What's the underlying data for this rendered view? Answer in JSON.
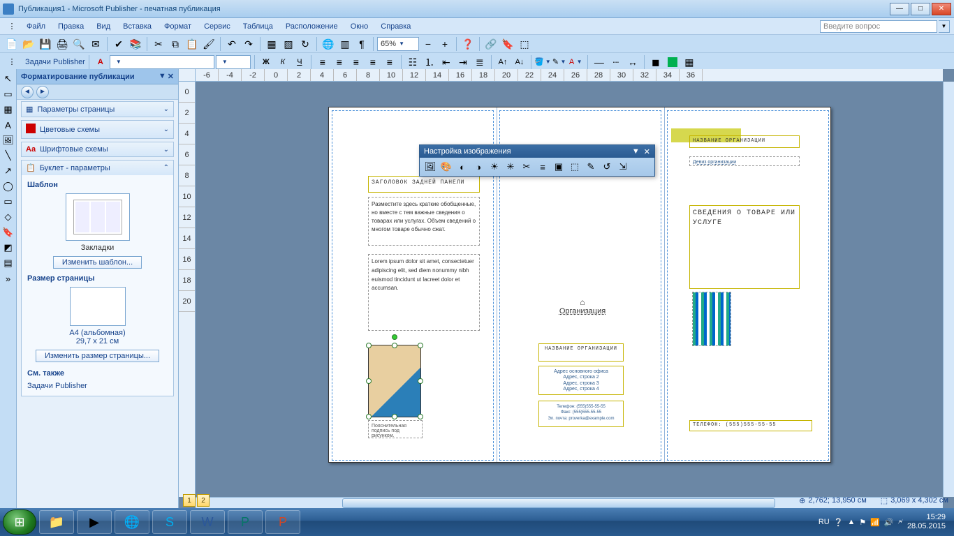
{
  "window": {
    "title": "Публикация1 - Microsoft Publisher - печатная публикация"
  },
  "menu": {
    "file": "Файл",
    "edit": "Правка",
    "view": "Вид",
    "insert": "Вставка",
    "format": "Формат",
    "tools": "Сервис",
    "table": "Таблица",
    "arrange": "Расположение",
    "window": "Окно",
    "help": "Справка",
    "help_placeholder": "Введите вопрос"
  },
  "toolbar1": {
    "zoom": "65%"
  },
  "toolbar2": {
    "tasks_label": "Задачи Publisher"
  },
  "taskpane": {
    "title": "Форматирование публикации",
    "sections": {
      "page_options": "Параметры страницы",
      "color_schemes": "Цветовые схемы",
      "font_schemes": "Шрифтовые схемы",
      "booklet_options": "Буклет - параметры"
    },
    "template_title": "Шаблон",
    "template_name": "Закладки",
    "change_template_btn": "Изменить шаблон...",
    "page_size_title": "Размер страницы",
    "page_size_name": "A4 (альбомная)",
    "page_size_dims": "29,7 x 21 см",
    "change_size_btn": "Изменить размер страницы...",
    "see_also": "См. также",
    "tasks_link": "Задачи Publisher"
  },
  "float_toolbar": {
    "title": "Настройка изображения"
  },
  "document": {
    "panel1": {
      "heading": "ЗАГОЛОВОК ЗАДНЕЙ ПАНЕЛИ",
      "body1": "Разместите здесь краткие обобщенные, но вместе с тем важные сведения о товарах или услугах. Объем сведений о многом товаре обычно сжат.",
      "body2": "Lorem ipsum dolor sit amet, consectetuer adipiscing elit, sed diem nonummy nibh euismod tincidunt ut lacreet dolor et accumsan.",
      "caption": "Пояснительная подпись под рисунком."
    },
    "panel2": {
      "org_label": "Организация",
      "org_name": "НАЗВАНИЕ ОРГАНИЗАЦИИ",
      "addr": "Адрес основного офиса\nАдрес, строка 2\nАдрес, строка 3\nАдрес, строка 4",
      "contact": "Телефон: (555)555-55-55\nФакс: (555)555-55-55\nЭл. почта: proverka@example.com"
    },
    "panel3": {
      "org_name": "НАЗВАНИЕ ОРГАНИЗАЦИИ",
      "slogan": "Девиз организации",
      "heading": "СВЕДЕНИЯ О ТОВАРЕ ИЛИ УСЛУГЕ",
      "phone": "ТЕЛЕФОН: (555)555-55-55"
    }
  },
  "status": {
    "pos": "2,762; 13,950 см",
    "size": "3,069 x  4,302 см"
  },
  "page_tabs": {
    "p1": "1",
    "p2": "2"
  },
  "systray": {
    "lang": "RU",
    "time": "15:29",
    "date": "28.05.2015"
  }
}
